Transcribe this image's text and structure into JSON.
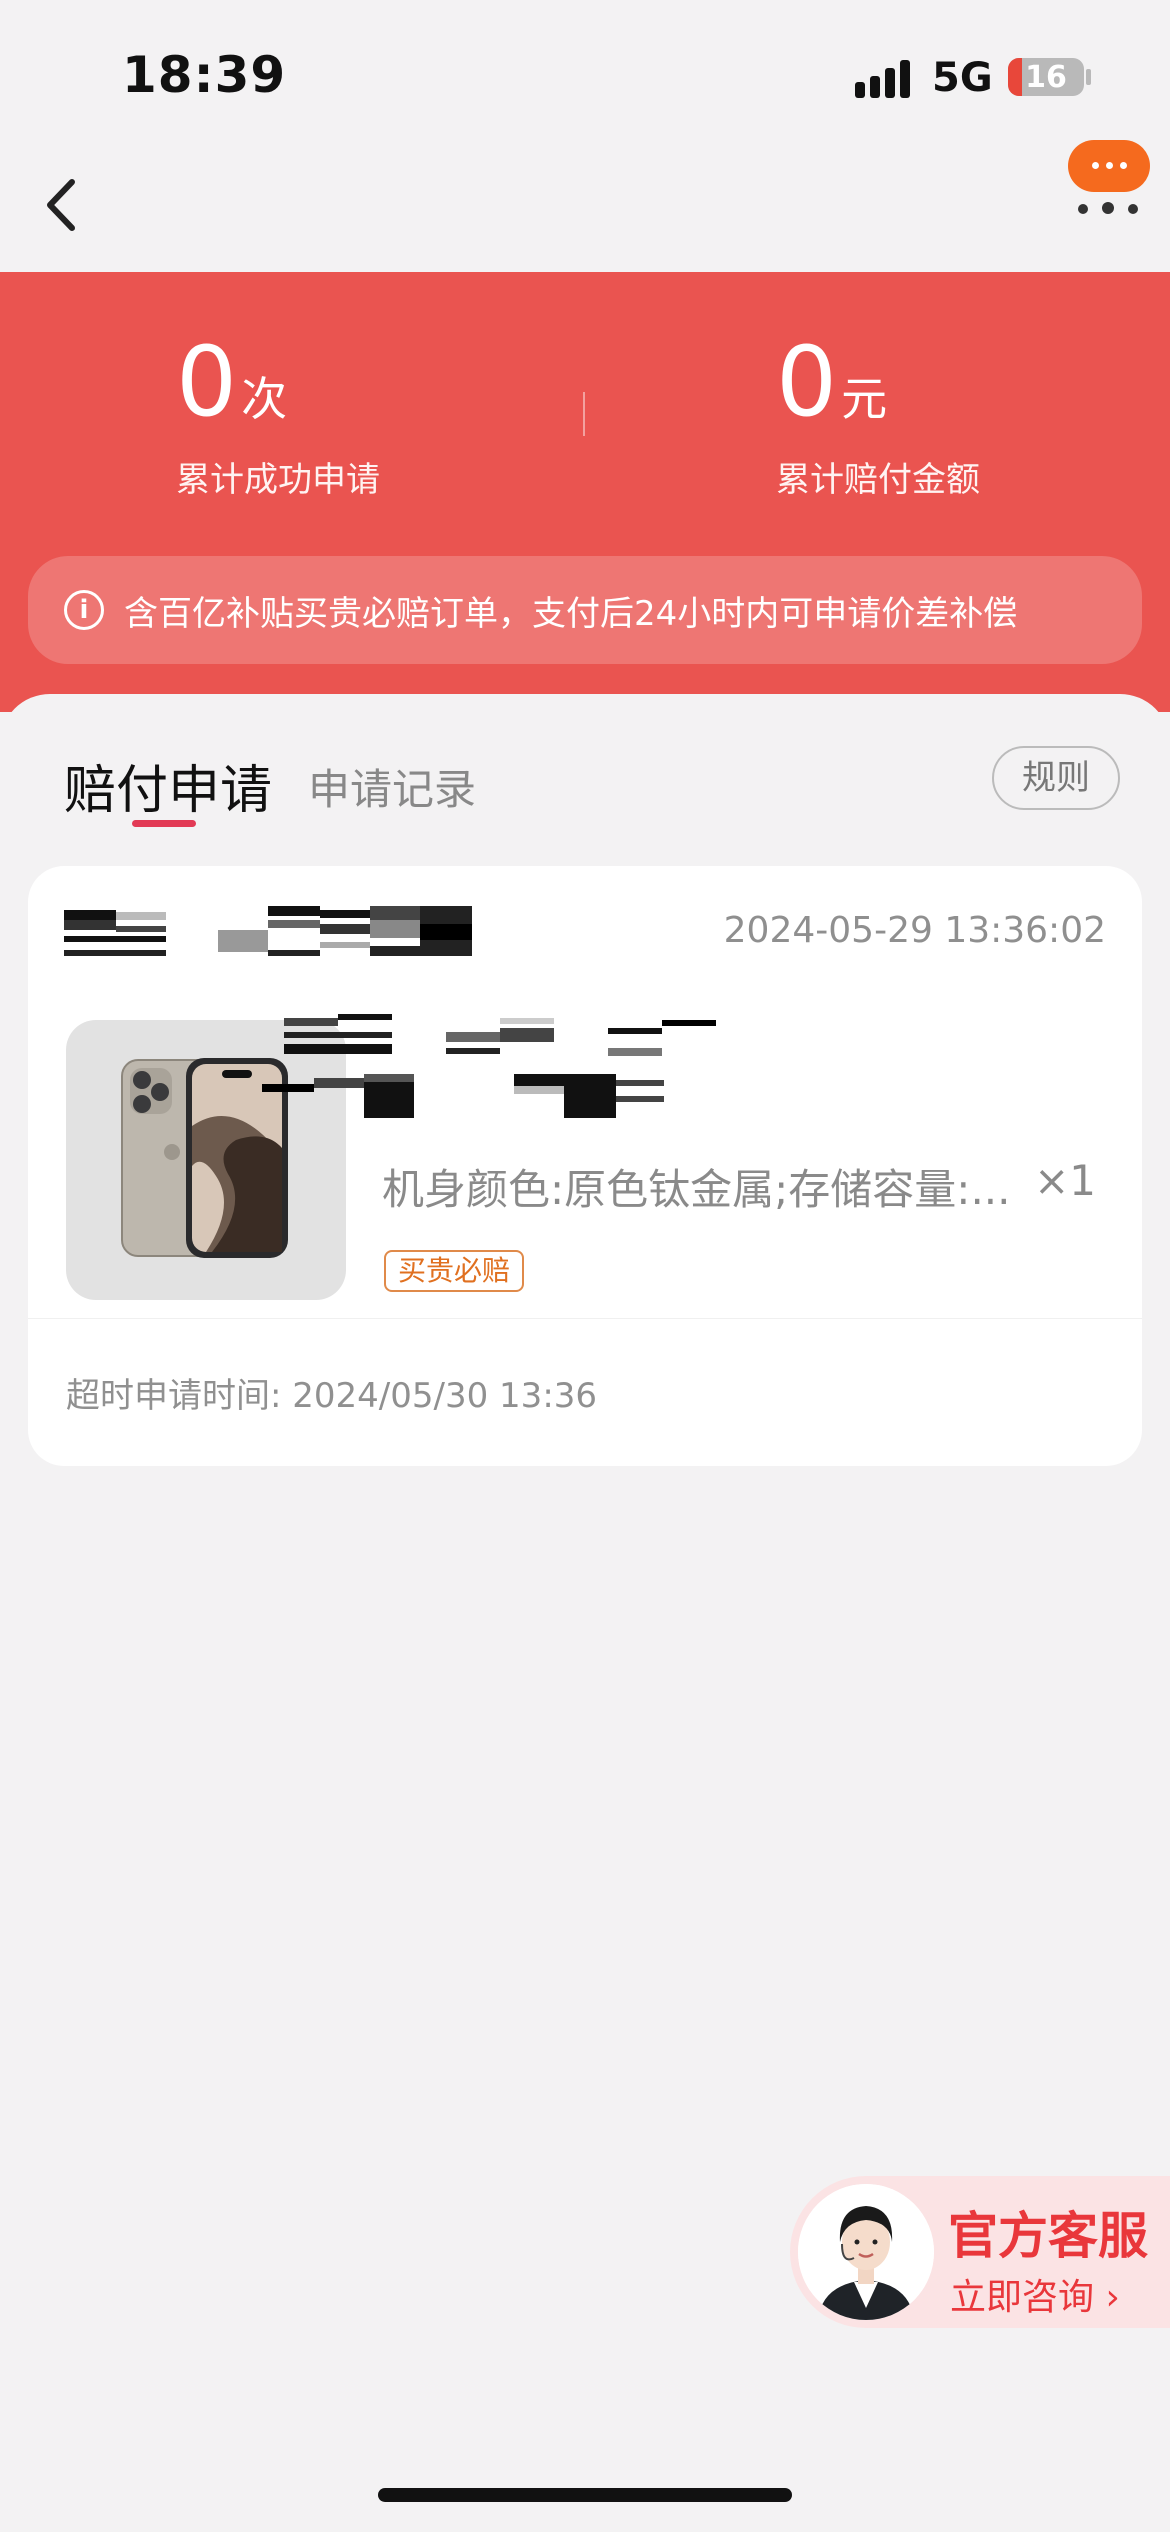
{
  "status_bar": {
    "time": "18:39",
    "network": "5G",
    "battery_level": "16"
  },
  "nav": {
    "back_icon": "chevron-left-icon",
    "more_icon": "more-dots-icon",
    "more_accent": "#f56a1e"
  },
  "header": {
    "background": "#ea5450",
    "stats": [
      {
        "value": "0",
        "unit": "次",
        "label": "累计成功申请"
      },
      {
        "value": "0",
        "unit": "元",
        "label": "累计赔付金额"
      }
    ],
    "notice": {
      "icon": "info-circle-icon",
      "text": "含百亿补贴买贵必赔订单，支付后24小时内可申请价差补偿"
    }
  },
  "tabs": {
    "items": [
      {
        "label": "赔付申请",
        "active": true
      },
      {
        "label": "申请记录",
        "active": false
      }
    ],
    "rules_label": "规则"
  },
  "order": {
    "time": "2024-05-29 13:36:02",
    "spec": "机身颜色:原色钛金属;存储容量:...",
    "quantity": "×1",
    "badge": "买贵必赔",
    "deadline_label": "超时申请时间:",
    "deadline_value": "2024/05/30 13:36"
  },
  "customer_service": {
    "title": "官方客服",
    "subtitle": "立即咨询",
    "accent": "#e9373b"
  }
}
